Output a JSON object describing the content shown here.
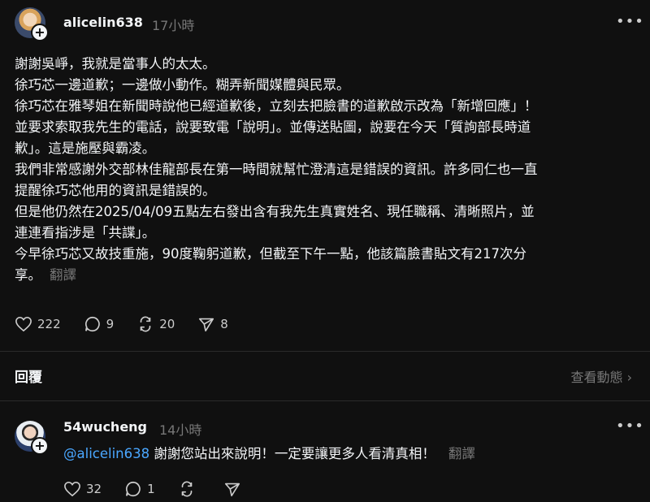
{
  "post": {
    "username": "alicelin638",
    "time": "17小時",
    "more_icon": "more-horizontal-icon",
    "lines": [
      "謝謝吳崢，我就是當事人的太太。",
      "徐巧芯一邊道歉；一邊做小動作。糊弄新聞媒體與民眾。",
      "徐巧芯在雅琴姐在新聞時說他已經道歉後，立刻去把臉書的道歉啟示改為「新增回應」！",
      "並要求索取我先生的電話，說要致電「說明」。並傳送貼圖，說要在今天「質詢部長時道",
      "歉」。這是施壓與霸凌。",
      "我們非常感謝外交部林佳龍部長在第一時間就幫忙澄清這是錯誤的資訊。許多同仁也一直",
      "提醒徐巧芯他用的資訊是錯誤的。",
      "但是他仍然在2025/04/09五點左右發出含有我先生真實姓名、現任職稱、清晰照片，並",
      "連連看指涉是「共諜」。",
      "今早徐巧芯又故技重施，90度鞠躬道歉，但截至下午一點，他該篇臉書貼文有217次分",
      "享。"
    ],
    "translate": "翻譯",
    "likes": "222",
    "comments": "9",
    "reposts": "20",
    "shares": "8"
  },
  "replies_header": {
    "title": "回覆",
    "view_activity": "查看動態 ›"
  },
  "reply": {
    "username": "54wucheng",
    "time": "14小時",
    "mention": "@alicelin638",
    "text": " 謝謝您站出來說明！一定要讓更多人看清真相！",
    "translate": "翻譯",
    "likes": "32",
    "comments": "1"
  }
}
